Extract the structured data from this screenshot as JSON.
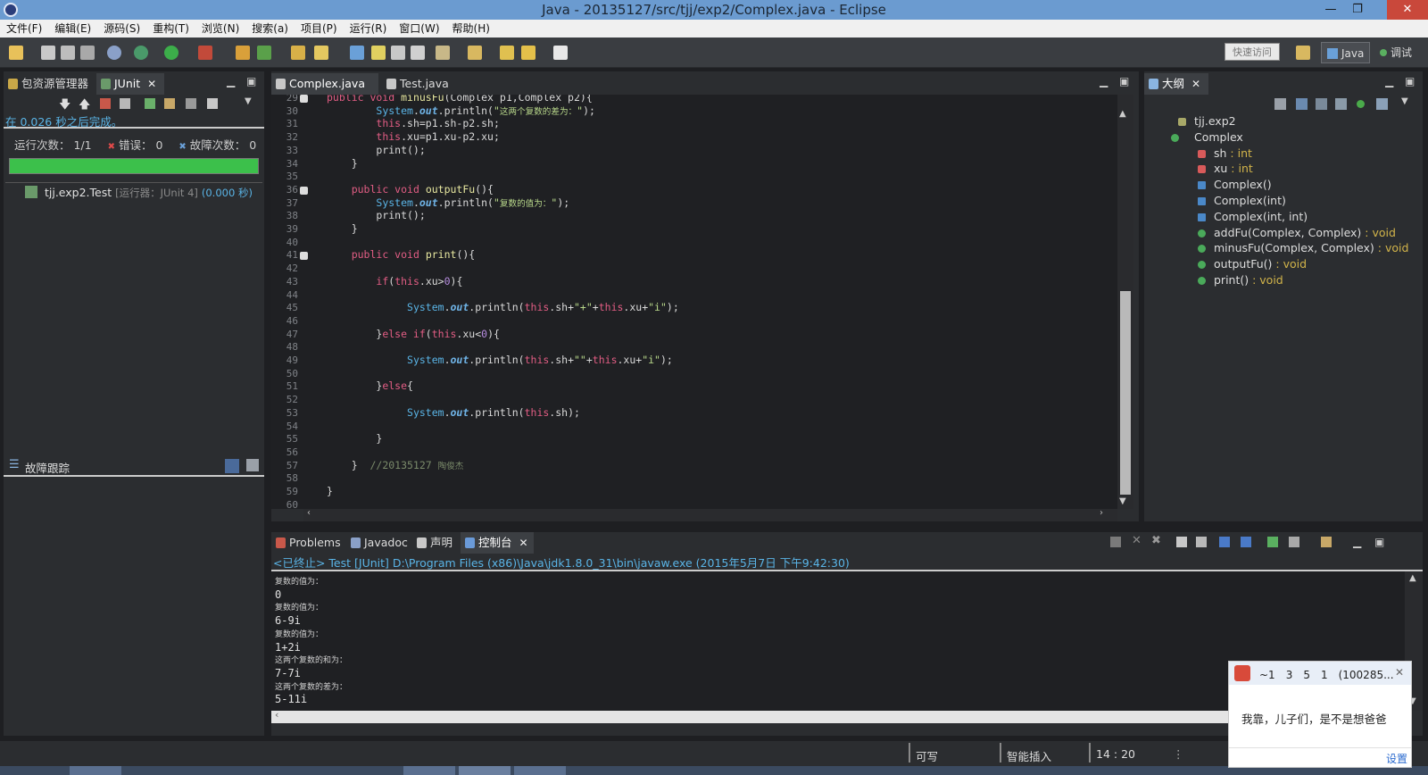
{
  "window": {
    "title": "Java - 20135127/src/tjj/exp2/Complex.java - Eclipse"
  },
  "menu": [
    "文件(F)",
    "编辑(E)",
    "源码(S)",
    "重构(T)",
    "浏览(N)",
    "搜索(a)",
    "项目(P)",
    "运行(R)",
    "窗口(W)",
    "帮助(H)"
  ],
  "toolbar": {
    "quick_access": "快速访问",
    "perspectives": [
      "Java",
      "调试"
    ]
  },
  "left_panel": {
    "tabs": [
      "包资源管理器",
      "JUnit"
    ],
    "junit_status": "在 0.026 秒之后完成。",
    "runs_label": "运行次数：",
    "runs_value": "1/1",
    "errors_label": "错误：",
    "errors_value": "0",
    "failures_label": "故障次数：",
    "failures_value": "0",
    "progress_fraction": 1.0,
    "progress_color": "#3cc04b",
    "test_name": "tjj.exp2.Test",
    "test_runner": "[运行器：JUnit 4]",
    "test_time": "(0.000 秒)",
    "failure_trace": "故障跟踪"
  },
  "editor": {
    "tabs": [
      "Complex.java",
      "Test.java"
    ],
    "lines": [
      {
        "n": "29",
        "fold": true,
        "html": "<span class=\"kw\">public void</span> <span class=\"fn\">minusFu</span>(Complex p1,Complex p2){"
      },
      {
        "n": "30",
        "html": "        <span class=\"sys\">System</span>.<span class=\"out\">out</span>.println(<span class=\"str\">\"<small>这两个复数的差为：</small>\"</span>);"
      },
      {
        "n": "31",
        "html": "        <span class=\"kw\">this</span>.sh=p1.sh-p2.sh;"
      },
      {
        "n": "32",
        "html": "        <span class=\"kw\">this</span>.xu=p1.xu-p2.xu;"
      },
      {
        "n": "33",
        "html": "        print();"
      },
      {
        "n": "34",
        "html": "    }"
      },
      {
        "n": "35",
        "html": ""
      },
      {
        "n": "36",
        "fold": true,
        "html": "    <span class=\"kw\">public void</span> <span class=\"fn\">outputFu</span>(){"
      },
      {
        "n": "37",
        "html": "        <span class=\"sys\">System</span>.<span class=\"out\">out</span>.println(<span class=\"str\">\"<small>复数的值为：</small>\"</span>);"
      },
      {
        "n": "38",
        "html": "        print();"
      },
      {
        "n": "39",
        "html": "    }"
      },
      {
        "n": "40",
        "html": ""
      },
      {
        "n": "41",
        "fold": true,
        "html": "    <span class=\"kw\">public void</span> <span class=\"fn\">print</span>(){"
      },
      {
        "n": "42",
        "html": ""
      },
      {
        "n": "43",
        "html": "        <span class=\"kw\">if</span>(<span class=\"kw\">this</span>.xu&gt;<span class=\"num\">0</span>){"
      },
      {
        "n": "44",
        "html": ""
      },
      {
        "n": "45",
        "html": "             <span class=\"sys\">System</span>.<span class=\"out\">out</span>.println(<span class=\"kw\">this</span>.sh+<span class=\"str\">\"+\"</span>+<span class=\"kw\">this</span>.xu+<span class=\"str\">\"i\"</span>);"
      },
      {
        "n": "46",
        "html": ""
      },
      {
        "n": "47",
        "html": "        }<span class=\"kw\">else if</span>(<span class=\"kw\">this</span>.xu&lt;<span class=\"num\">0</span>){"
      },
      {
        "n": "48",
        "html": ""
      },
      {
        "n": "49",
        "html": "             <span class=\"sys\">System</span>.<span class=\"out\">out</span>.println(<span class=\"kw\">this</span>.sh+<span class=\"str\">\"\"</span>+<span class=\"kw\">this</span>.xu+<span class=\"str\">\"i\"</span>);"
      },
      {
        "n": "50",
        "html": ""
      },
      {
        "n": "51",
        "html": "        }<span class=\"kw\">else</span>{"
      },
      {
        "n": "52",
        "html": ""
      },
      {
        "n": "53",
        "html": "             <span class=\"sys\">System</span>.<span class=\"out\">out</span>.println(<span class=\"kw\">this</span>.sh);"
      },
      {
        "n": "54",
        "html": ""
      },
      {
        "n": "55",
        "html": "        }"
      },
      {
        "n": "56",
        "html": ""
      },
      {
        "n": "57",
        "html": "    }  <span class=\"cmt\">//20135127 <small>陶俊杰</small></span>"
      },
      {
        "n": "58",
        "html": ""
      },
      {
        "n": "59",
        "html": "}"
      },
      {
        "n": "60",
        "html": ""
      }
    ]
  },
  "outline": {
    "tab": "大纲",
    "items": [
      {
        "label": "tjj.exp2",
        "type": "",
        "kind": "pkg"
      },
      {
        "label": "Complex",
        "type": "",
        "kind": "class"
      },
      {
        "label": "sh",
        "type": " : int",
        "kind": "field"
      },
      {
        "label": "xu",
        "type": " : int",
        "kind": "field"
      },
      {
        "label": "Complex()",
        "type": "",
        "kind": "ctor"
      },
      {
        "label": "Complex(int)",
        "type": "",
        "kind": "ctor"
      },
      {
        "label": "Complex(int, int)",
        "type": "",
        "kind": "ctor"
      },
      {
        "label": "addFu(Complex, Complex)",
        "type": " : void",
        "kind": "method"
      },
      {
        "label": "minusFu(Complex, Complex)",
        "type": " : void",
        "kind": "method"
      },
      {
        "label": "outputFu()",
        "type": " : void",
        "kind": "method"
      },
      {
        "label": "print()",
        "type": " : void",
        "kind": "method"
      }
    ]
  },
  "console": {
    "tabs": [
      "Problems",
      "Javadoc",
      "声明",
      "控制台"
    ],
    "header": "<已终止> Test [JUnit] D:\\Program Files (x86)\\Java\\jdk1.8.0_31\\bin\\javaw.exe (2015年5月7日 下午9:42:30)",
    "lines": [
      {
        "t": "复数的值为：",
        "small": true
      },
      {
        "t": "0",
        "small": false
      },
      {
        "t": "复数的值为：",
        "small": true
      },
      {
        "t": "6-9i",
        "small": false
      },
      {
        "t": "复数的值为：",
        "small": true
      },
      {
        "t": "1+2i",
        "small": false
      },
      {
        "t": "这两个复数的和为：",
        "small": true
      },
      {
        "t": "7-7i",
        "small": false
      },
      {
        "t": "这两个复数的差为：",
        "small": true
      },
      {
        "t": "5-11i",
        "small": false
      }
    ]
  },
  "statusbar": {
    "writable": "可写",
    "insert": "智能插入",
    "position": "14 : 20"
  },
  "notification": {
    "sender": "~1　3　5　1　(100285...",
    "message": "我靠，儿子们，是不是想爸爸",
    "settings": "设置"
  }
}
